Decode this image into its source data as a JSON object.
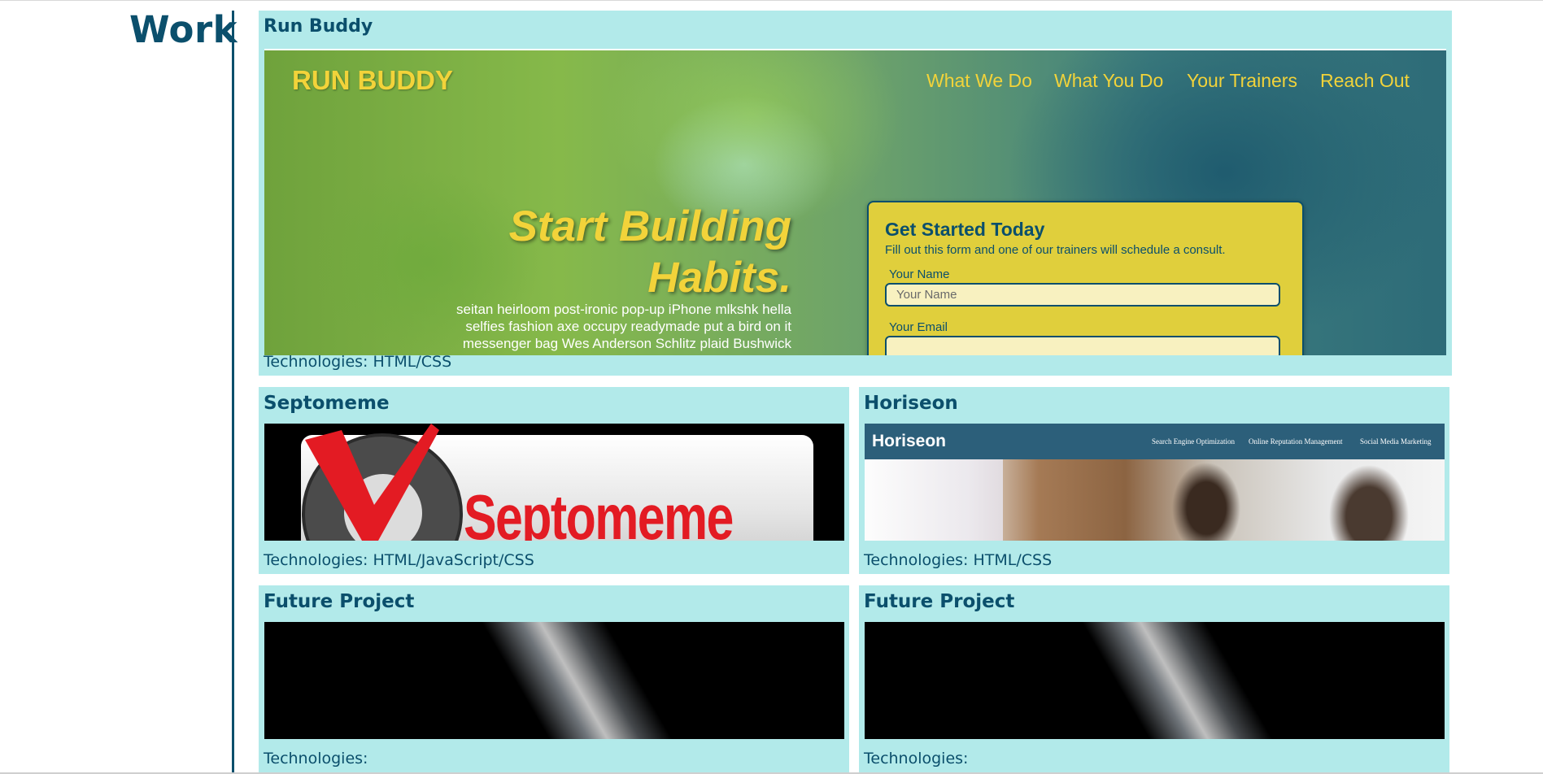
{
  "section": {
    "title": "Work"
  },
  "projects": {
    "featured": {
      "title": "Run Buddy",
      "technologies": "Technologies: HTML/CSS",
      "preview": {
        "brand": "RUN BUDDY",
        "nav": [
          "What We Do",
          "What You Do",
          "Your Trainers",
          "Reach Out"
        ],
        "headline_1": "Start Building",
        "headline_2": "Habits.",
        "body": "seitan heirloom post-ironic pop-up iPhone mlkshk hella selfies fashion axe occupy readymade put a bird on it messenger bag Wes Anderson Schlitz plaid Bushwick",
        "form_title": "Get Started Today",
        "form_subtitle": "Fill out this form and one of our trainers will schedule a consult.",
        "name_label": "Your Name",
        "name_placeholder": "Your Name",
        "email_label": "Your Email"
      }
    },
    "septomeme": {
      "title": "Septomeme",
      "technologies": "Technologies: HTML/JavaScript/CSS",
      "preview": {
        "logo_text": "Septomeme"
      }
    },
    "horiseon": {
      "title": "Horiseon",
      "technologies": "Technologies: HTML/CSS",
      "preview": {
        "logo": "Horiseon",
        "nav": [
          "Search Engine Optimization",
          "Online Reputation Management",
          "Social Media Marketing"
        ]
      }
    },
    "future_1": {
      "title": "Future Project",
      "technologies": "Technologies:"
    },
    "future_2": {
      "title": "Future Project",
      "technologies": "Technologies:"
    }
  },
  "colors": {
    "accent": "#0b4f6c",
    "card_bg": "#b2eaea",
    "run_buddy_yellow": "#f2d33a",
    "septomeme_red": "#e31b23"
  }
}
